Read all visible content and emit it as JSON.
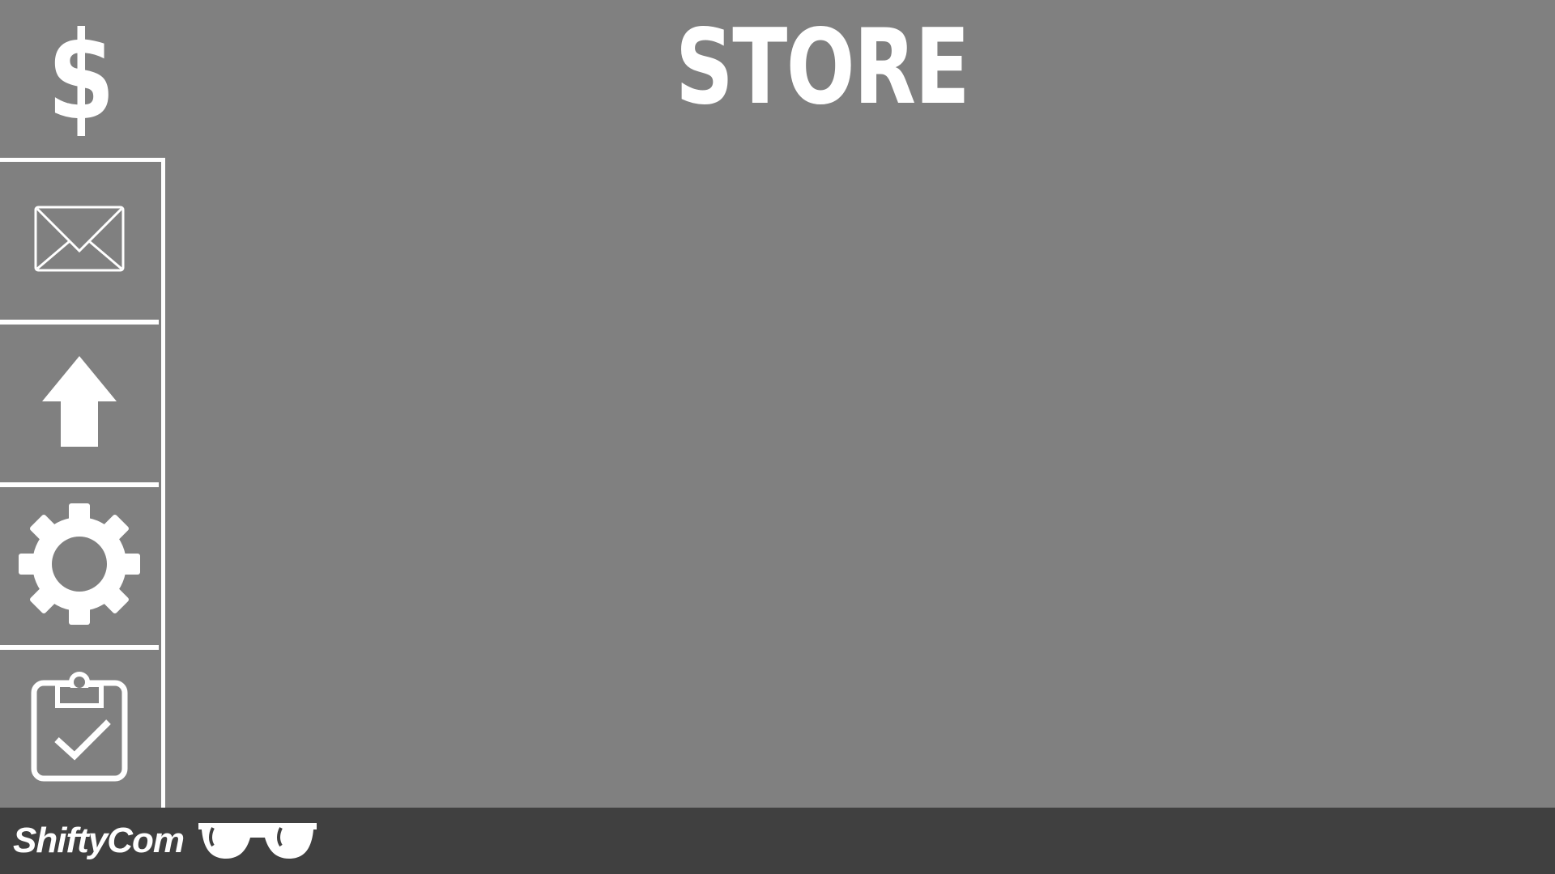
{
  "header": {
    "title": "STORE",
    "store_icon": {
      "glyph": "$",
      "icon": "dollar-icon"
    }
  },
  "sidebar": {
    "items": [
      {
        "id": "messages",
        "icon": "envelope-icon"
      },
      {
        "id": "upgrades",
        "icon": "arrow-up-icon"
      },
      {
        "id": "settings",
        "icon": "gear-icon"
      },
      {
        "id": "tasks",
        "icon": "clipboard-check-icon"
      }
    ]
  },
  "footer": {
    "brand": "ShiftyCom",
    "brand_icon": "sunglasses-icon"
  },
  "colors": {
    "background": "#808080",
    "footer": "#404040",
    "foreground": "#ffffff"
  }
}
